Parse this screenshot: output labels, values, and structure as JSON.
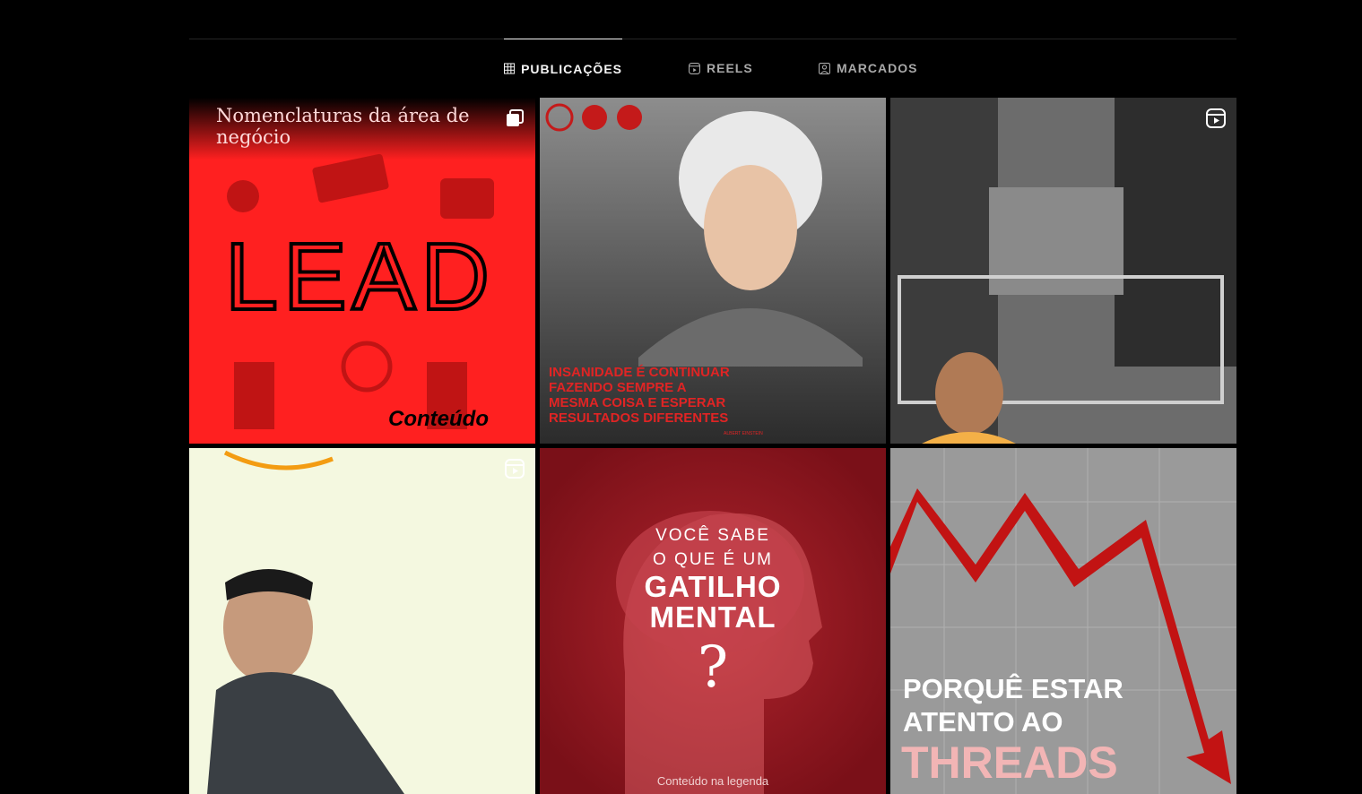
{
  "tabs": [
    {
      "label": "PUBLICAÇÕES",
      "icon": "grid-icon",
      "active": true
    },
    {
      "label": "REELS",
      "icon": "reels-icon",
      "active": false
    },
    {
      "label": "MARCADOS",
      "icon": "tagged-icon",
      "active": false
    }
  ],
  "posts": [
    {
      "type": "carousel",
      "title": "Nomenclaturas da área de negócio",
      "headline": "LEAD",
      "cta": "Conteúdo",
      "bg": "#ff2020"
    },
    {
      "type": "image",
      "quote_lines": [
        "INSANIDADE É CONTINUAR",
        "FAZENDO SEMPRE A",
        "MESMA COISA E ESPERAR",
        "RESULTADOS DIFERENTES"
      ],
      "author": "ALBERT EINSTEIN",
      "bg": "#3a3a3a"
    },
    {
      "type": "reel",
      "bg": "#6c6c6c"
    },
    {
      "type": "reel",
      "bg": "#f4f8e0"
    },
    {
      "type": "image",
      "lines": [
        "VOCÊ SABE",
        "O QUE É UM",
        "GATILHO",
        "MENTAL",
        "?"
      ],
      "footer": "Conteúdo na legenda",
      "bg": "#8f1a22"
    },
    {
      "type": "image",
      "lines": [
        "PORQUÊ ESTAR",
        "ATENTO AO"
      ],
      "highlight": "THREADS",
      "bg": "#9a9a9a"
    }
  ]
}
